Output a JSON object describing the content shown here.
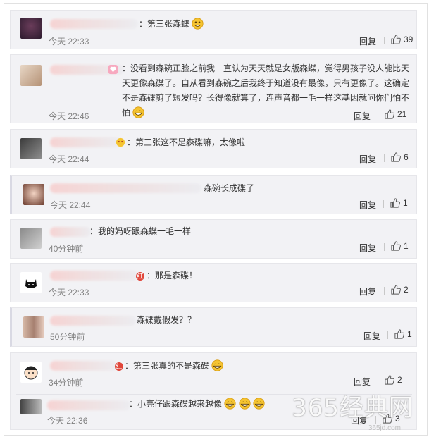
{
  "comments": [
    {
      "text": "：第三张森蝶",
      "time": "今天 22:33",
      "reply": "回复",
      "likes": "39"
    },
    {
      "text": "：没看到森碗正脸之前我一直认为天天就是女版森蝶，觉得男孩子没人能比天天更像森碟了。自从看到森碗之后我终于知道没有最像，只有更像了。这确定不是森碟剪了短发吗？长得像就算了，连声音都一毛一样这基因就问你们怕不怕",
      "time": "今天 22:46",
      "reply": "回复",
      "likes": "21"
    },
    {
      "text": "：第三张这不是森碟嘛，太像啦",
      "time": "今天 22:44",
      "reply": "回复",
      "likes": "6"
    },
    {
      "text": "森碗长成碟了",
      "time": "今天 22:44",
      "reply": "回复",
      "likes": "1"
    },
    {
      "text": "：我的妈呀跟森蝶一毛一样",
      "time": "40分钟前",
      "reply": "回复",
      "likes": "1"
    },
    {
      "text": "：那是森碟！",
      "time": "今天 22:33",
      "reply": "回复",
      "likes": "2"
    },
    {
      "text": "森碟戴假发？？",
      "time": "50分钟前",
      "reply": "回复",
      "likes": "1"
    },
    {
      "text": "：第三张真的不是森碟",
      "time": "34分钟前",
      "reply": "回复",
      "likes": "2"
    },
    {
      "text": "：小亮仔跟森碟越来越像",
      "time": "今天 22:36",
      "reply": "回复",
      "likes": "3"
    }
  ],
  "badge_label": "红",
  "watermark": {
    "main": "365经典网",
    "sub": "365jd.com"
  },
  "icons": {
    "like": "thumbs-up-icon",
    "emoji": "grinning-face-icon"
  },
  "colors": {
    "card_bg": "#f2f2f5",
    "time": "#808080",
    "badge": "#e0463a"
  }
}
